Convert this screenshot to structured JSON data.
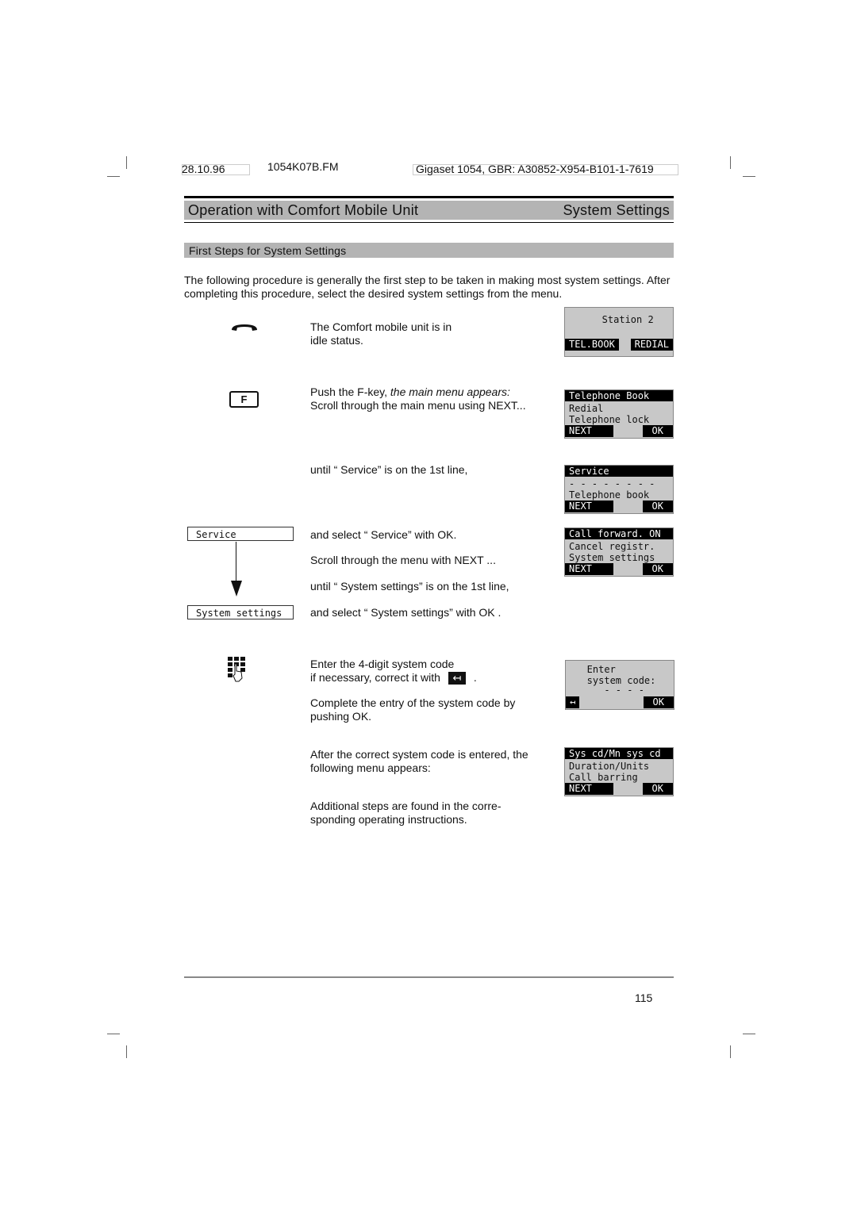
{
  "header": {
    "date": "28.10.96",
    "filename": "1054K07B.FM",
    "doc_ref": "Gigaset 1054, GBR: A30852-X954-B101-1-7619"
  },
  "title": {
    "left": "Operation with Comfort Mobile Unit",
    "right": "System Settings"
  },
  "section": {
    "title": "First Steps for System Settings",
    "intro": "The following procedure is generally the first step to be taken in making most system settings. After completing this procedure, select the desired system settings from the menu."
  },
  "steps": {
    "idle": "The Comfort mobile unit is in idle status.",
    "fkey_label": "F",
    "fkey_text": "Push the F-key, ",
    "fkey_italic": "the main menu appears:",
    "scroll_main": "Scroll through the main menu using NEXT...",
    "until_service": "until “ Service”  is on the 1st line,",
    "select_service": "and select “ Service”  with OK.",
    "scroll_menu": "Scroll through the menu with NEXT ...",
    "until_system": "until “ System settings”  is on the 1st line,",
    "select_system": "and select “ System settings”  with OK .",
    "enter_code": "Enter the 4-digit system code",
    "correct_prefix": "if necessary, correct it with",
    "correct_suffix": ".",
    "backspace_glyph": "↤",
    "complete": "Complete the entry of the system code by pushing OK.",
    "after_correct": "After the correct system code is entered, the following menu appears:",
    "additional": "Additional steps are found in the corre- sponding operating instructions."
  },
  "flow": {
    "from": "Service",
    "to": "System settings"
  },
  "displays": [
    {
      "rows": [
        "",
        "   Station 2",
        ""
      ],
      "inverted_first": false,
      "keys": [
        "TEL.BOOK",
        "REDIAL"
      ]
    },
    {
      "rows": [
        "Telephone Book",
        "Redial",
        "Telephone lock"
      ],
      "inverted_first": true,
      "keys": [
        "NEXT   ",
        "OK"
      ]
    },
    {
      "rows": [
        "Service",
        "- - - - - - - -",
        "Telephone book"
      ],
      "inverted_first": true,
      "keys": [
        "NEXT   ",
        "OK"
      ]
    },
    {
      "rows": [
        "Call forward. ON",
        "Cancel registr.",
        "System settings"
      ],
      "inverted_first": true,
      "keys": [
        "NEXT   ",
        "OK"
      ]
    },
    {
      "rows": [
        "   Enter",
        "   system code:",
        "      - - - -"
      ],
      "inverted_first": false,
      "keys": [
        "↤",
        "OK"
      ]
    },
    {
      "rows": [
        "Sys cd/Mn sys cd",
        "Duration/Units",
        "Call barring"
      ],
      "inverted_first": true,
      "keys": [
        "NEXT   ",
        "OK"
      ]
    }
  ],
  "footer": {
    "page_number": "115"
  }
}
